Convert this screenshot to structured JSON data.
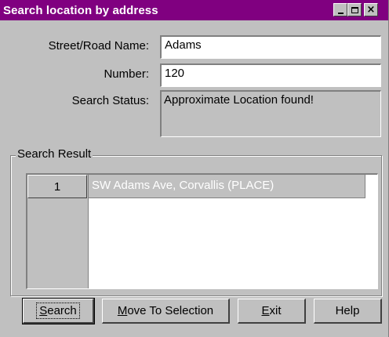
{
  "window": {
    "title": "Search location by address",
    "minimize_icon": "minimize-icon",
    "maximize_icon": "maximize-icon",
    "close_icon": "close-icon",
    "title_bar_color": "#800080"
  },
  "form": {
    "street_label": "Street/Road Name:",
    "street_value": "Adams",
    "number_label": "Number:",
    "number_value": "120",
    "status_label": "Search Status:",
    "status_value": "Approximate Location found!"
  },
  "results": {
    "group_title": "Search Result",
    "rows": [
      {
        "index": "1",
        "text": "SW Adams Ave, Corvallis (PLACE)"
      }
    ]
  },
  "buttons": {
    "search": {
      "prefix": "",
      "mnemonic": "S",
      "rest": "earch"
    },
    "move": {
      "prefix": "",
      "mnemonic": "M",
      "rest": "ove To Selection"
    },
    "exit": {
      "prefix": "",
      "mnemonic": "E",
      "rest": "xit"
    },
    "help": {
      "label": "Help"
    }
  }
}
